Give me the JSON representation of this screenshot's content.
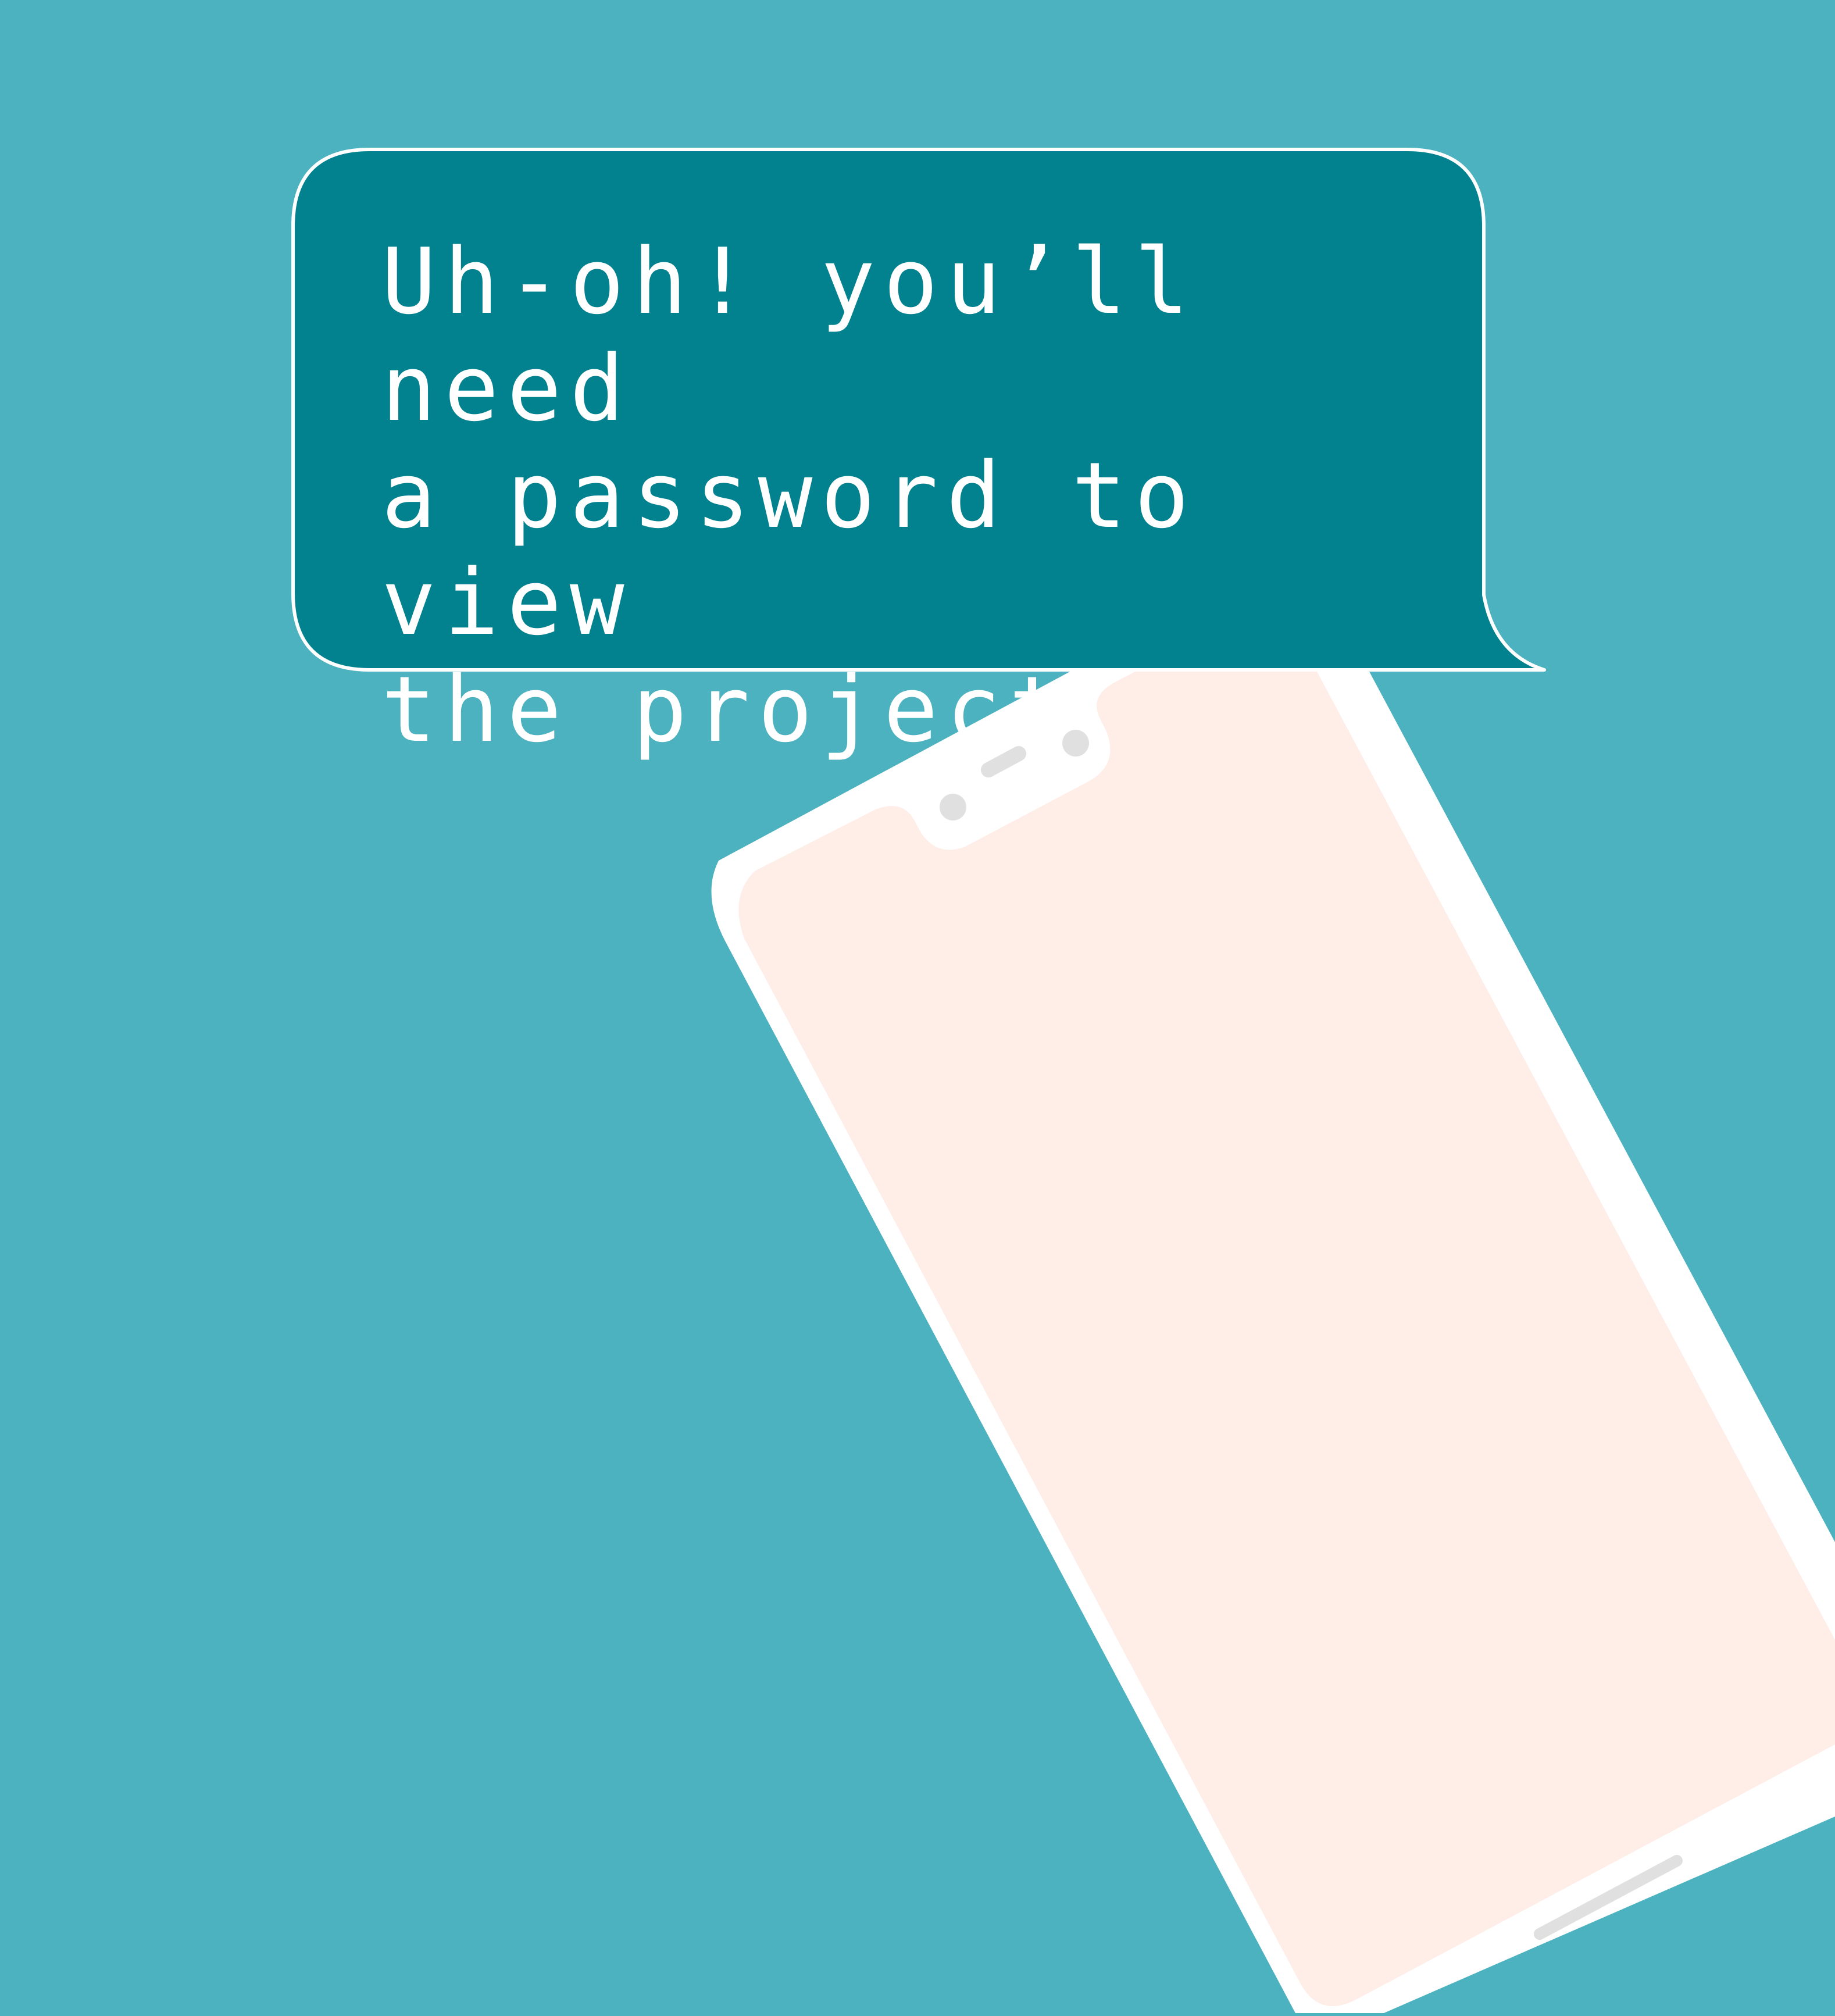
{
  "message": {
    "text": "Uh-oh! you’ll need\na password to view\nthe project."
  },
  "colors": {
    "background": "#4cb2bf",
    "bubble_fill": "#02818f",
    "bubble_outline": "#ffffff",
    "phone_frame": "#ffffff",
    "phone_screen": "#ffede7",
    "sensor_gray": "#e0e0e0"
  },
  "icons": {
    "device": "smartphone-illustration",
    "bubble": "speech-bubble"
  }
}
